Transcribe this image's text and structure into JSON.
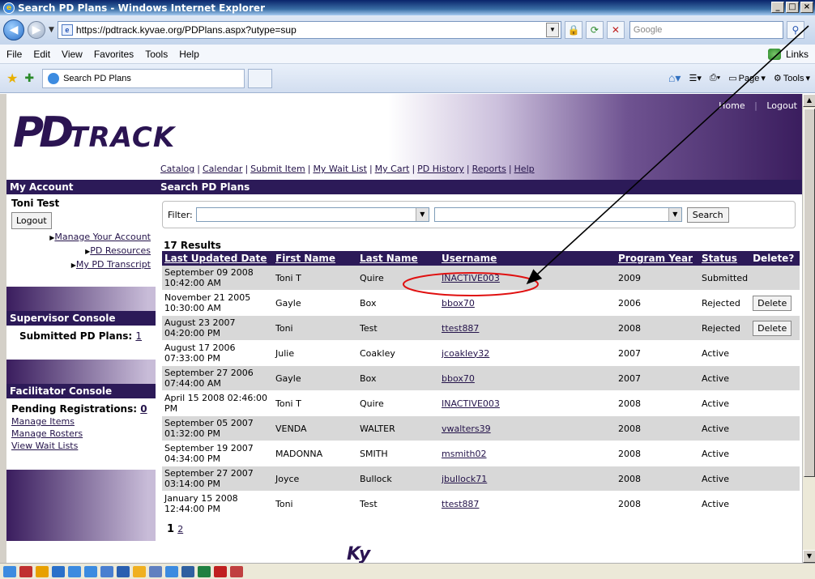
{
  "window": {
    "title": "Search PD Plans - Windows Internet Explorer",
    "url": "https://pdtrack.kyvae.org/PDPlans.aspx?utype=sup",
    "search_placeholder": "Google"
  },
  "menu": [
    "File",
    "Edit",
    "View",
    "Favorites",
    "Tools",
    "Help"
  ],
  "links_label": "Links",
  "tab": {
    "label": "Search PD Plans"
  },
  "commands": {
    "page": "Page",
    "tools": "Tools"
  },
  "site": {
    "logo_pd": "PD",
    "logo_track": "TRACK",
    "top_links": {
      "home": "Home",
      "logout": "Logout"
    },
    "nav": [
      "Catalog",
      "Calendar",
      "Submit Item",
      "My Wait List",
      "My Cart",
      "PD History",
      "Reports",
      "Help"
    ]
  },
  "sidebar": {
    "my_account": {
      "title": "My Account",
      "user": "Toni Test",
      "logout": "Logout",
      "links": [
        "Manage Your Account",
        "PD Resources",
        "My PD Transcript"
      ]
    },
    "supervisor": {
      "title": "Supervisor Console",
      "submitted_label": "Submitted PD Plans:",
      "submitted_count": "1"
    },
    "facilitator": {
      "title": "Facilitator Console",
      "pending_label": "Pending Registrations:",
      "pending_count": "0",
      "links": [
        "Manage Items",
        "Manage Rosters",
        "View Wait Lists"
      ]
    }
  },
  "main": {
    "title": "Search PD Plans",
    "filter_label": "Filter:",
    "search_button": "Search",
    "results": "17 Results",
    "columns": [
      "Last Updated Date",
      "First Name",
      "Last Name",
      "Username",
      "Program Year",
      "Status",
      "Delete?"
    ],
    "rows": [
      {
        "date": "September 09 2008 10:42:00 AM",
        "first": "Toni T",
        "last": "Quire",
        "user": "INACTIVE003",
        "year": "2009",
        "status": "Submitted",
        "delete": ""
      },
      {
        "date": "November 21 2005 10:30:00 AM",
        "first": "Gayle",
        "last": "Box",
        "user": "bbox70",
        "year": "2006",
        "status": "Rejected",
        "delete": "Delete"
      },
      {
        "date": "August 23 2007 04:20:00 PM",
        "first": "Toni",
        "last": "Test",
        "user": "ttest887",
        "year": "2008",
        "status": "Rejected",
        "delete": "Delete"
      },
      {
        "date": "August 17 2006 07:33:00 PM",
        "first": "Julie",
        "last": "Coakley",
        "user": "jcoakley32",
        "year": "2007",
        "status": "Active",
        "delete": ""
      },
      {
        "date": "September 27 2006 07:44:00 AM",
        "first": "Gayle",
        "last": "Box",
        "user": "bbox70",
        "year": "2007",
        "status": "Active",
        "delete": ""
      },
      {
        "date": "April 15 2008 02:46:00 PM",
        "first": "Toni T",
        "last": "Quire",
        "user": "INACTIVE003",
        "year": "2008",
        "status": "Active",
        "delete": ""
      },
      {
        "date": "September 05 2007 01:32:00 PM",
        "first": "VENDA",
        "last": "WALTER",
        "user": "vwalters39",
        "year": "2008",
        "status": "Active",
        "delete": ""
      },
      {
        "date": "September 19 2007 04:34:00 PM",
        "first": "MADONNA",
        "last": "SMITH",
        "user": "msmith02",
        "year": "2008",
        "status": "Active",
        "delete": ""
      },
      {
        "date": "September 27 2007 03:14:00 PM",
        "first": "Joyce",
        "last": "Bullock",
        "user": "jbullock71",
        "year": "2008",
        "status": "Active",
        "delete": ""
      },
      {
        "date": "January 15 2008 12:44:00 PM",
        "first": "Toni",
        "last": "Test",
        "user": "ttest887",
        "year": "2008",
        "status": "Active",
        "delete": ""
      }
    ],
    "pager": {
      "current": "1",
      "next": "2"
    }
  },
  "colors": {
    "accent": "#2c1a58",
    "annotation": "#e01010"
  }
}
